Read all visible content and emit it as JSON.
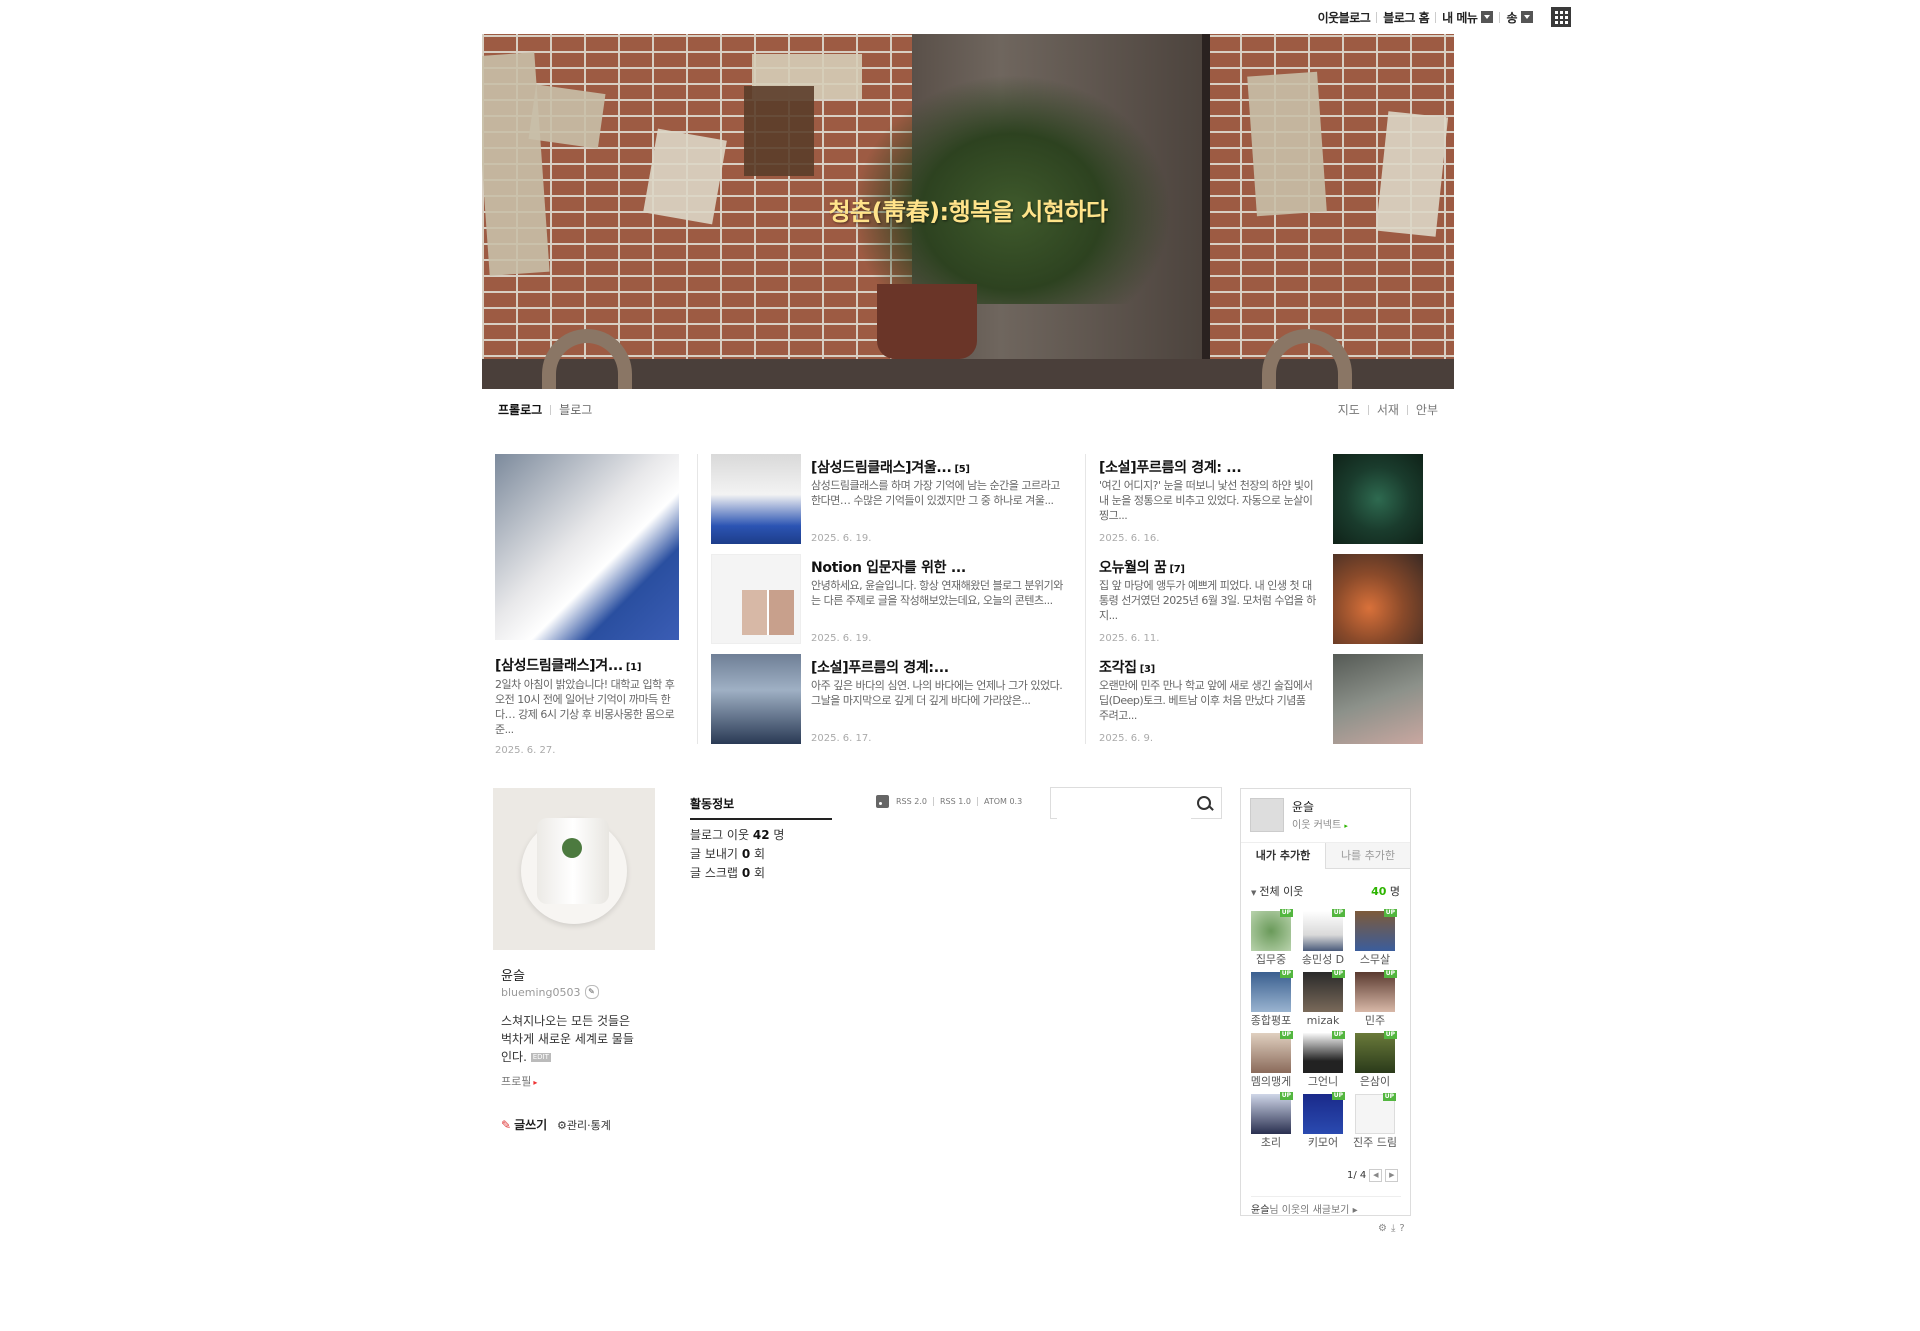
{
  "gnb": {
    "items": [
      "이웃블로그",
      "블로그 홈",
      "내 메뉴",
      "송"
    ],
    "apps_icon": "grid-apps-icon"
  },
  "header": {
    "title": "청춘(靑春):행복을 시현하다"
  },
  "menu": {
    "left": [
      "프롤로그",
      "블로그"
    ],
    "right": [
      "지도",
      "서재",
      "안부"
    ]
  },
  "featured": {
    "title": "[삼성드림클래스]겨...",
    "count": "[1]",
    "body": "2일차 아침이 밝았습니다! 대학교 입학 후 오전 10시 전에 일어난 기억이 까마득 한다… 강제 6시 기상 후 비몽사몽한 몸으로 준...",
    "date": "2025. 6. 27."
  },
  "posts": [
    {
      "title": "[삼성드림클래스]겨울...",
      "count": "[5]",
      "body": "삼성드림클래스를 하며 가장 기억에 남는 순간을 고르라고 한다면… 수많은 기억들이 있겠지만 그 중 하나로 겨울...",
      "date": "2025. 6. 19."
    },
    {
      "title": "Notion 입문자를 위한 ...",
      "count": "",
      "body": "안녕하세요, 윤슬입니다. 항상 연재해왔던 블로그 분위기와는 다른 주제로 글을 작성해보았는데요, 오늘의 콘텐츠...",
      "date": "2025. 6. 19."
    },
    {
      "title": "[소설]푸르름의 경계:...",
      "count": "",
      "body": "아주 깊은 바다의 심연. 나의 바다에는 언제나 그가 있었다. 그날을 마지막으로 깊게 더 깊게 바다에 가라앉은...",
      "date": "2025. 6. 17."
    },
    {
      "title": "[소설]푸르름의 경계: ...",
      "count": "",
      "body": "'여긴 어디지?' 눈을 떠보니 낯선 천장의 하얀 빛이 내 눈을 정통으로 비추고 있었다. 자동으로 눈살이 찡그...",
      "date": "2025. 6. 16."
    },
    {
      "title": "오뉴월의 꿈",
      "count": "[7]",
      "body": "집 앞 마당에 앵두가 예쁘게 피었다. 내 인생 첫 대통령 선거였던 2025년 6월 3일. 모처럼 수업을 하지...",
      "date": "2025. 6. 11."
    },
    {
      "title": "조각집",
      "count": "[3]",
      "body": "오랜만에 민주 만나 학교 앞에 새로 생긴 술집에서 딥(Deep)토크. 베트남 이후 처음 만났다 기념품 주려고...",
      "date": "2025. 6. 9."
    }
  ],
  "profile": {
    "nickname": "윤슬",
    "user_id": "blueming0503",
    "intro": "스쳐지나오는 모든 것들은 벅차게 새로운 세계로 물들인다.",
    "edit_badge": "EDIT",
    "profile_link": "프로필",
    "write": "글쓰기",
    "manage": "관리·통계"
  },
  "activity": {
    "title": "활동정보",
    "lines": [
      {
        "label": "블로그 이웃",
        "value": "42",
        "unit": "명"
      },
      {
        "label": "글 보내기",
        "value": "0",
        "unit": "회"
      },
      {
        "label": "글 스크랩",
        "value": "0",
        "unit": "회"
      }
    ]
  },
  "rss": [
    "RSS 2.0",
    "RSS 1.0",
    "ATOM 0.3"
  ],
  "search": {
    "placeholder": ""
  },
  "neighbors": {
    "name": "윤슬",
    "connect": "이웃 커넥트",
    "tabs": [
      "내가 추가한",
      "나를 추가한"
    ],
    "all_label": "전체 이웃",
    "count": "40",
    "count_unit": "명",
    "up_badge": "UP",
    "items": [
      "집무중",
      "송민성 D",
      "스무살",
      "종합평포",
      "mizak",
      "민주",
      "멤의맹게",
      "그언니",
      "은삼이",
      "초리",
      "키모어",
      "진주 드림"
    ],
    "page": "1/ 4",
    "footer_name": "윤슬",
    "footer_text": "님 이웃의 새글보기"
  }
}
